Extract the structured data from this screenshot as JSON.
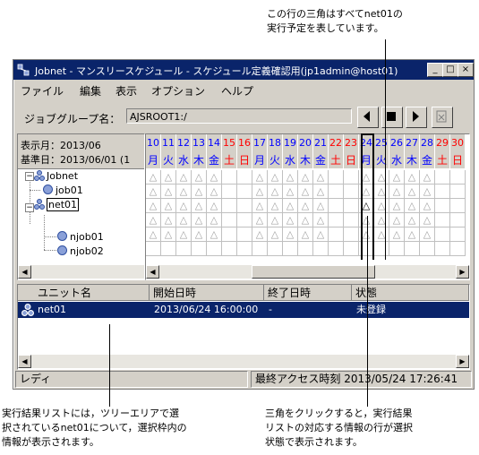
{
  "annotations": {
    "top": "この行の三角はすべてnet01の\n実行予定を表しています。",
    "bottom_left": "実行結果リストには，ツリーエリアで選\n択されているnet01について，選択枠内の\n情報が表示されます。",
    "bottom_right": "三角をクリックすると，実行結果\nリストの対応する情報の行が選択\n状態で表示されます。"
  },
  "window": {
    "title": "Jobnet - マンスリースケジュール - スケジュール定義確認用(jp1admin@host01)",
    "controls": {
      "minimize": "_",
      "maximize": "□",
      "close": "×"
    }
  },
  "menu": [
    "ファイル",
    "編集",
    "表示",
    "オプション",
    "ヘルプ"
  ],
  "jobgroup": {
    "label": "ジョブグループ名：",
    "value": "AJSROOT1:/"
  },
  "date_info": {
    "display_month": "表示月：2013/06",
    "base_date": "基準日：2013/06/01 (1"
  },
  "tree": {
    "root": "Jobnet",
    "items": [
      "job01",
      "net01",
      "njob01",
      "njob02"
    ]
  },
  "calendar": {
    "days": [
      "10",
      "11",
      "12",
      "13",
      "14",
      "15",
      "16",
      "17",
      "18",
      "19",
      "20",
      "21",
      "22",
      "23",
      "24",
      "25",
      "26",
      "27",
      "28",
      "29",
      "30"
    ],
    "weekdays": [
      "月",
      "火",
      "水",
      "木",
      "金",
      "土",
      "日",
      "月",
      "火",
      "水",
      "木",
      "金",
      "土",
      "日",
      "月",
      "火",
      "水",
      "木",
      "金",
      "土",
      "日"
    ],
    "colors": {
      "weekday": "#0000ff",
      "sat": "#ff0000",
      "sun": "#ff0000"
    },
    "triangle": "△"
  },
  "list": {
    "columns": [
      "ユニット名",
      "開始日時",
      "終了日時",
      "状態"
    ],
    "rows": [
      {
        "unit": "net01",
        "start": "2013/06/24 16:00:00",
        "end": "-",
        "status": "未登録"
      }
    ]
  },
  "status": {
    "left": "レディ",
    "right": "最終アクセス時刻 2013/05/24 17:26:41"
  }
}
